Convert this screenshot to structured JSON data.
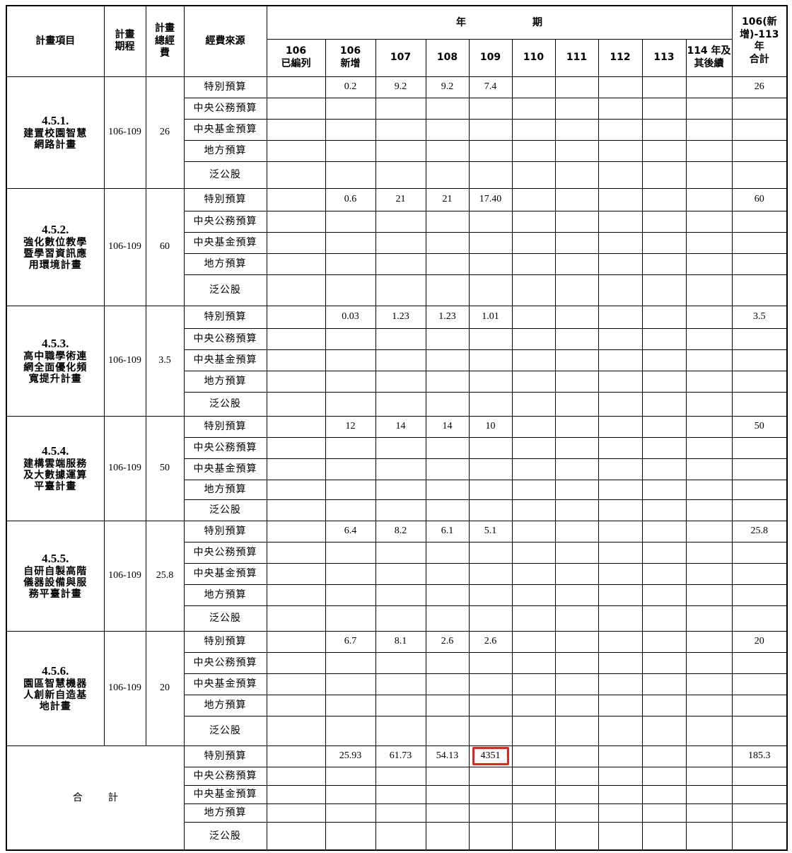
{
  "header": {
    "item": "計畫項目",
    "period": "計畫期程",
    "total": "計畫總經費",
    "source": "經費來源",
    "years_title": "年　期",
    "y106_existing": [
      "106",
      "已編列"
    ],
    "y106_new": [
      "106",
      "新增"
    ],
    "y107": "107",
    "y108": "108",
    "y109": "109",
    "y110": "110",
    "y111": "111",
    "y112": "112",
    "y113": "113",
    "y114": [
      "114 年及",
      "其後續"
    ],
    "sum": [
      "106(新",
      "增)-113",
      "年",
      "合計"
    ]
  },
  "sources": [
    "特別預算",
    "中央公務預算",
    "中央基金預算",
    "地方預算",
    "泛公股"
  ],
  "plans": [
    {
      "code": "4.5.1.",
      "title": [
        "建置校園智慧",
        "網路計畫"
      ],
      "period": "106-109",
      "total": "26",
      "special": {
        "y106_new": "0.2",
        "y107": "9.2",
        "y108": "9.2",
        "y109": "7.4",
        "sum": "26"
      }
    },
    {
      "code": "4.5.2.",
      "title": [
        "強化數位教學",
        "暨學習資訊應",
        "用環境計畫"
      ],
      "period": "106-109",
      "total": "60",
      "special": {
        "y106_new": "0.6",
        "y107": "21",
        "y108": "21",
        "y109": "17.40",
        "sum": "60"
      }
    },
    {
      "code": "4.5.3.",
      "title": [
        "高中職學術連",
        "網全面優化頻",
        "寬提升計畫"
      ],
      "period": "106-109",
      "total": "3.5",
      "special": {
        "y106_new": "0.03",
        "y107": "1.23",
        "y108": "1.23",
        "y109": "1.01",
        "sum": "3.5"
      }
    },
    {
      "code": "4.5.4.",
      "title": [
        "建構雲端服務",
        "及大數據運算",
        "平臺計畫"
      ],
      "period": "106-109",
      "total": "50",
      "special": {
        "y106_new": "12",
        "y107": "14",
        "y108": "14",
        "y109": "10",
        "sum": "50"
      }
    },
    {
      "code": "4.5.5.",
      "title": [
        "自研自製高階",
        "儀器設備與服",
        "務平臺計畫"
      ],
      "period": "106-109",
      "total": "25.8",
      "special": {
        "y106_new": "6.4",
        "y107": "8.2",
        "y108": "6.1",
        "y109": "5.1",
        "sum": "25.8"
      }
    },
    {
      "code": "4.5.6.",
      "title": [
        "園區智慧機器",
        "人創新自造基",
        "地計畫"
      ],
      "period": "106-109",
      "total": "20",
      "special": {
        "y106_new": "6.7",
        "y107": "8.1",
        "y108": "2.6",
        "y109": "2.6",
        "sum": "20"
      }
    }
  ],
  "grand_total": {
    "label": "合計",
    "special": {
      "y106_new": "25.93",
      "y107": "61.73",
      "y108": "54.13",
      "y109": "4351",
      "sum": "185.3"
    }
  },
  "highlight_color": "#e0251b"
}
